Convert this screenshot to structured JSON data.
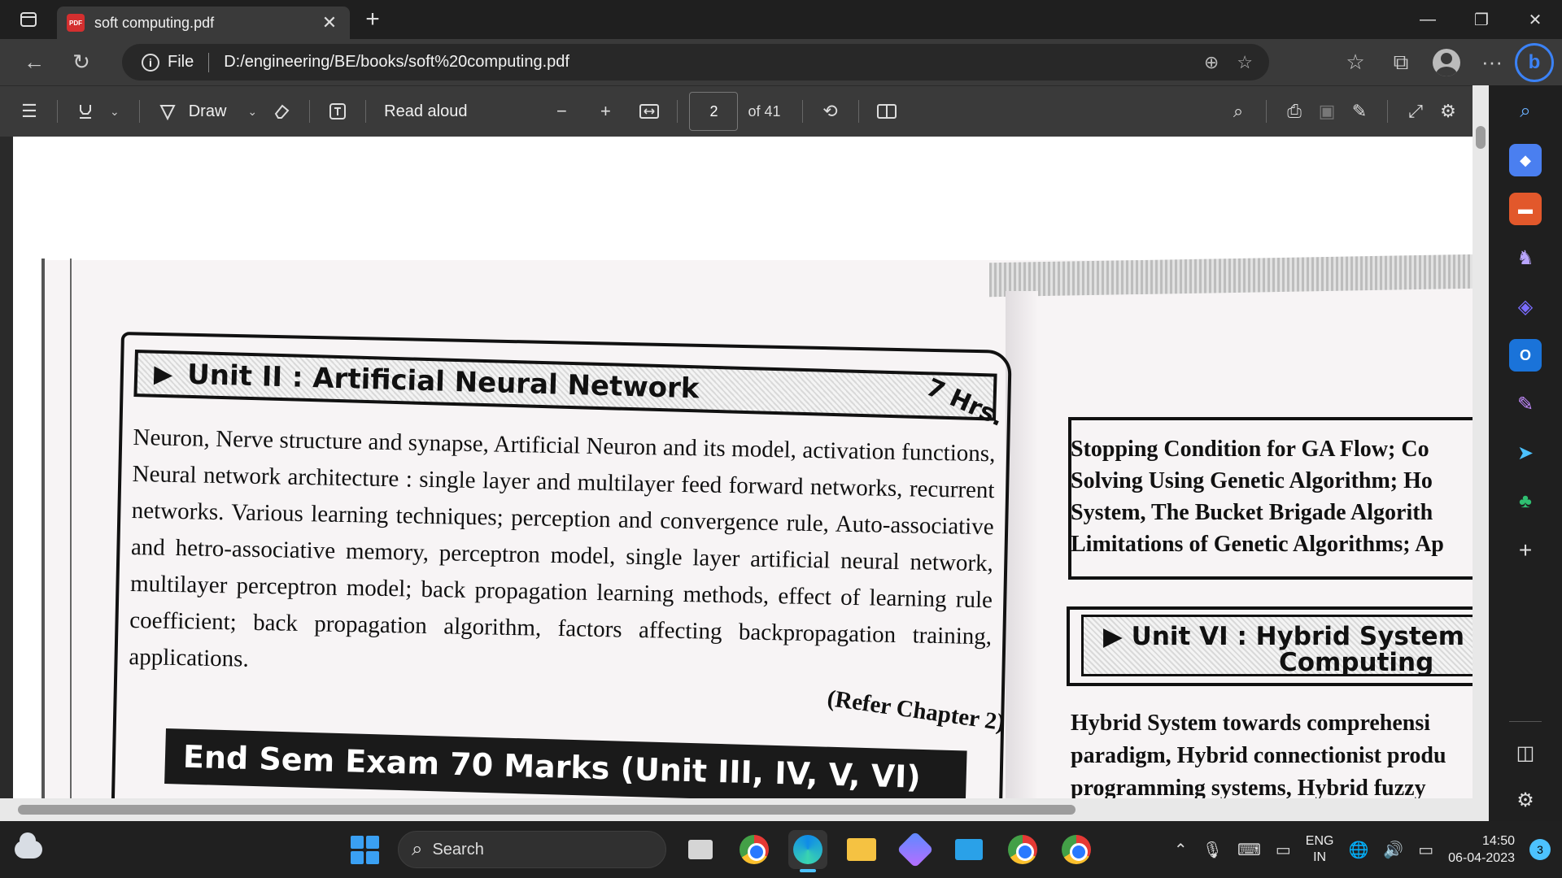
{
  "browser": {
    "tab": {
      "title": "soft computing.pdf",
      "icon": "pdf-icon",
      "close": "✕"
    },
    "new_tab": "+",
    "window": {
      "minimize": "—",
      "maximize": "❐",
      "close": "✕"
    },
    "nav": {
      "back": "←",
      "refresh": "↻",
      "more": "···"
    },
    "address": {
      "scheme_label": "File",
      "url": "D:/engineering/BE/books/soft%20computing.pdf"
    },
    "accent_color": "#3b82f6"
  },
  "pdf_toolbar": {
    "draw_label": "Draw",
    "read_aloud_label": "Read aloud",
    "zoom_out": "−",
    "zoom_in": "+",
    "page_current": "2",
    "page_total_label": "of 41"
  },
  "document": {
    "unit2_title": "Unit II : Artificial Neural Network",
    "unit2_hours": "7 Hrs.",
    "unit2_body": "Neuron, Nerve structure and synapse, Artificial Neuron and its model, activation functions, Neural network architecture : single layer and multilayer feed forward networks, recurrent networks. Various learning techniques; perception and convergence rule, Auto-associative and hetro-associative memory, perceptron model, single layer artificial neural network, multilayer perceptron model; back propagation learning methods, effect of learning rule coefficient; back propagation algorithm, factors affecting backpropagation training, applications.",
    "refer": "(Refer Chapter 2)",
    "end_sem": "End Sem Exam 70 Marks (Unit III, IV, V, VI)",
    "right_text_lines": [
      "Stopping Condition for GA Flow; Co",
      "Solving Using Genetic Algorithm; Ho",
      "System, The Bucket Brigade Algorith",
      "Limitations of Genetic Algorithms; Ap"
    ],
    "unit6_title_line1": "Unit VI : Hybrid System a",
    "unit6_title_line2": "Computing",
    "right_body_lines": [
      "Hybrid System towards comprehensi",
      "paradigm, Hybrid connectionist produ",
      "programming systems, Hybrid fuzzy"
    ]
  },
  "taskbar": {
    "search_label": "Search",
    "lang_line1": "ENG",
    "lang_line2": "IN",
    "time": "14:50",
    "date": "06-04-2023",
    "notifications": "3"
  }
}
